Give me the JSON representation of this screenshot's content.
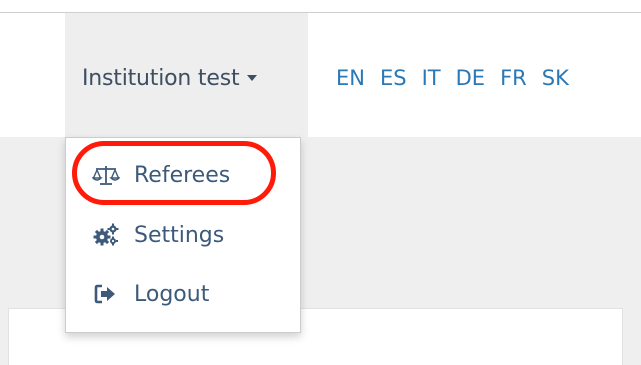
{
  "header": {
    "user_menu_label": "Institution test",
    "languages": [
      "EN",
      "ES",
      "IT",
      "DE",
      "FR",
      "SK"
    ]
  },
  "dropdown": {
    "items": [
      {
        "label": "Referees",
        "icon": "balance-scale-icon",
        "highlighted": true
      },
      {
        "label": "Settings",
        "icon": "gears-icon"
      },
      {
        "label": "Logout",
        "icon": "sign-out-icon"
      }
    ]
  },
  "colors": {
    "link": "#2b78b7",
    "menu_text": "#3d5a7a",
    "highlight": "#ff1a0a"
  }
}
